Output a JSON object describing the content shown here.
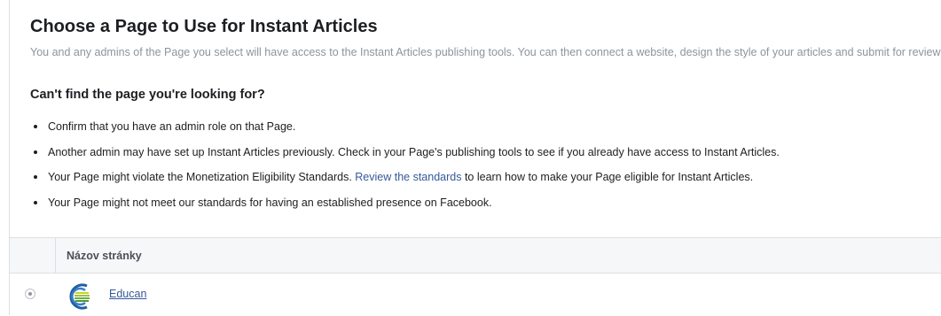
{
  "heading": "Choose a Page to Use for Instant Articles",
  "description": "You and any admins of the Page you select will have access to the Instant Articles publishing tools. You can then connect a website, design the style of your articles and submit for review.",
  "subheading": "Can't find the page you're looking for?",
  "bullets": {
    "b0": "Confirm that you have an admin role on that Page.",
    "b1": "Another admin may have set up Instant Articles previously. Check in your Page's publishing tools to see if you already have access to Instant Articles.",
    "b2_before": "Your Page might violate the Monetization Eligibility Standards. ",
    "b2_link": "Review the standards",
    "b2_after": " to learn how to make your Page eligible for Instant Articles.",
    "b3": "Your Page might not meet our standards for having an established presence on Facebook."
  },
  "table": {
    "column_header": "Názov stránky",
    "rows": [
      {
        "name": "Educan",
        "selected": true,
        "logo_icon": "educan-logo"
      }
    ]
  },
  "colors": {
    "link": "#365899",
    "muted_text": "#8d949e",
    "header_bg": "#f6f7f9",
    "border": "#dddfe2"
  }
}
